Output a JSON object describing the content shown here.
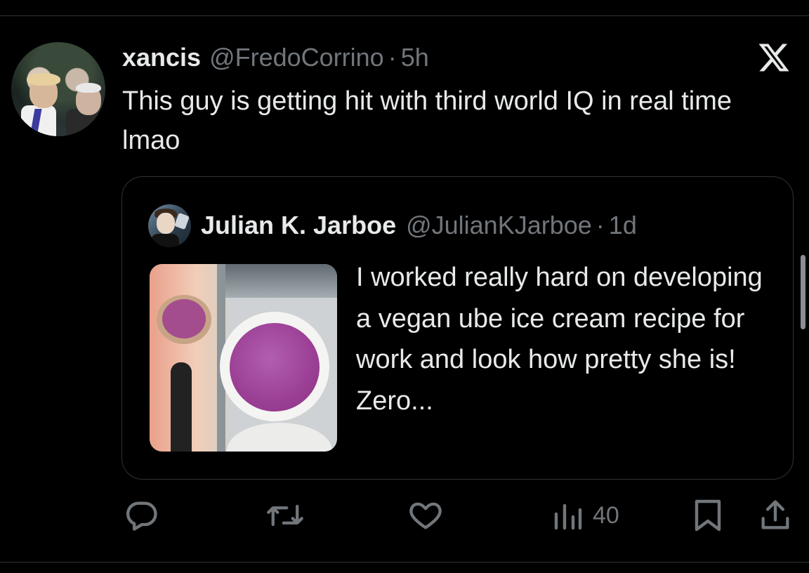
{
  "tweet": {
    "author_name": "xancis",
    "author_handle": "@FredoCorrino",
    "separator": "·",
    "time": "5h",
    "text": "This guy is getting hit with third world IQ in real time lmao",
    "avatar_icon": "profile-photo",
    "brand_icon": "x-logo-icon"
  },
  "quote": {
    "author_name": "Julian K. Jarboe",
    "author_handle": "@JulianKJarboe",
    "separator": "·",
    "time": "1d",
    "text": "I worked really hard on developing a vegan ube ice cream recipe for work and look how pretty she is! Zero...",
    "media": "ice-cream-photo"
  },
  "actions": {
    "reply_icon": "reply-icon",
    "retweet_icon": "retweet-icon",
    "like_icon": "heart-icon",
    "views_icon": "views-icon",
    "views_count": "40",
    "bookmark_icon": "bookmark-icon",
    "share_icon": "share-icon"
  },
  "colors": {
    "background": "#000000",
    "text": "#e7e9ea",
    "secondary_text": "#71767b",
    "border": "#2f3336"
  }
}
